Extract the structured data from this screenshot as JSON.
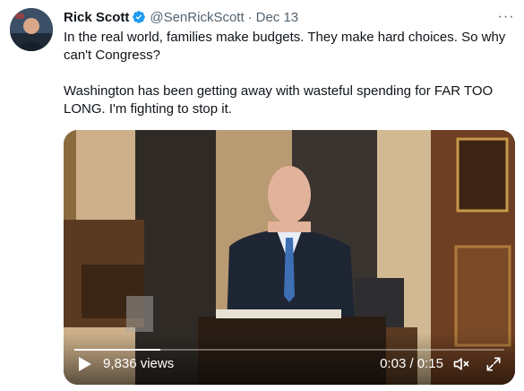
{
  "tweet": {
    "author_name": "Rick Scott",
    "handle": "@SenRickScott",
    "separator": "·",
    "date": "Dec 13",
    "more_label": "···",
    "text_line1": "In the real world, families make budgets. They make hard choices. So why can't Congress?",
    "text_line2": "Washington has been getting away with wasteful spending for FAR TOO LONG. I'm fighting to stop it."
  },
  "video": {
    "views": "9,836 views",
    "time": "0:03 / 0:15",
    "progress_fraction": 0.2,
    "icons": {
      "play": "play-icon",
      "mute": "volume-muted-icon",
      "fullscreen": "fullscreen-icon"
    }
  },
  "colors": {
    "verified_blue": "#1d9bf0",
    "secondary_text": "#536471",
    "primary_text": "#0f1419"
  }
}
